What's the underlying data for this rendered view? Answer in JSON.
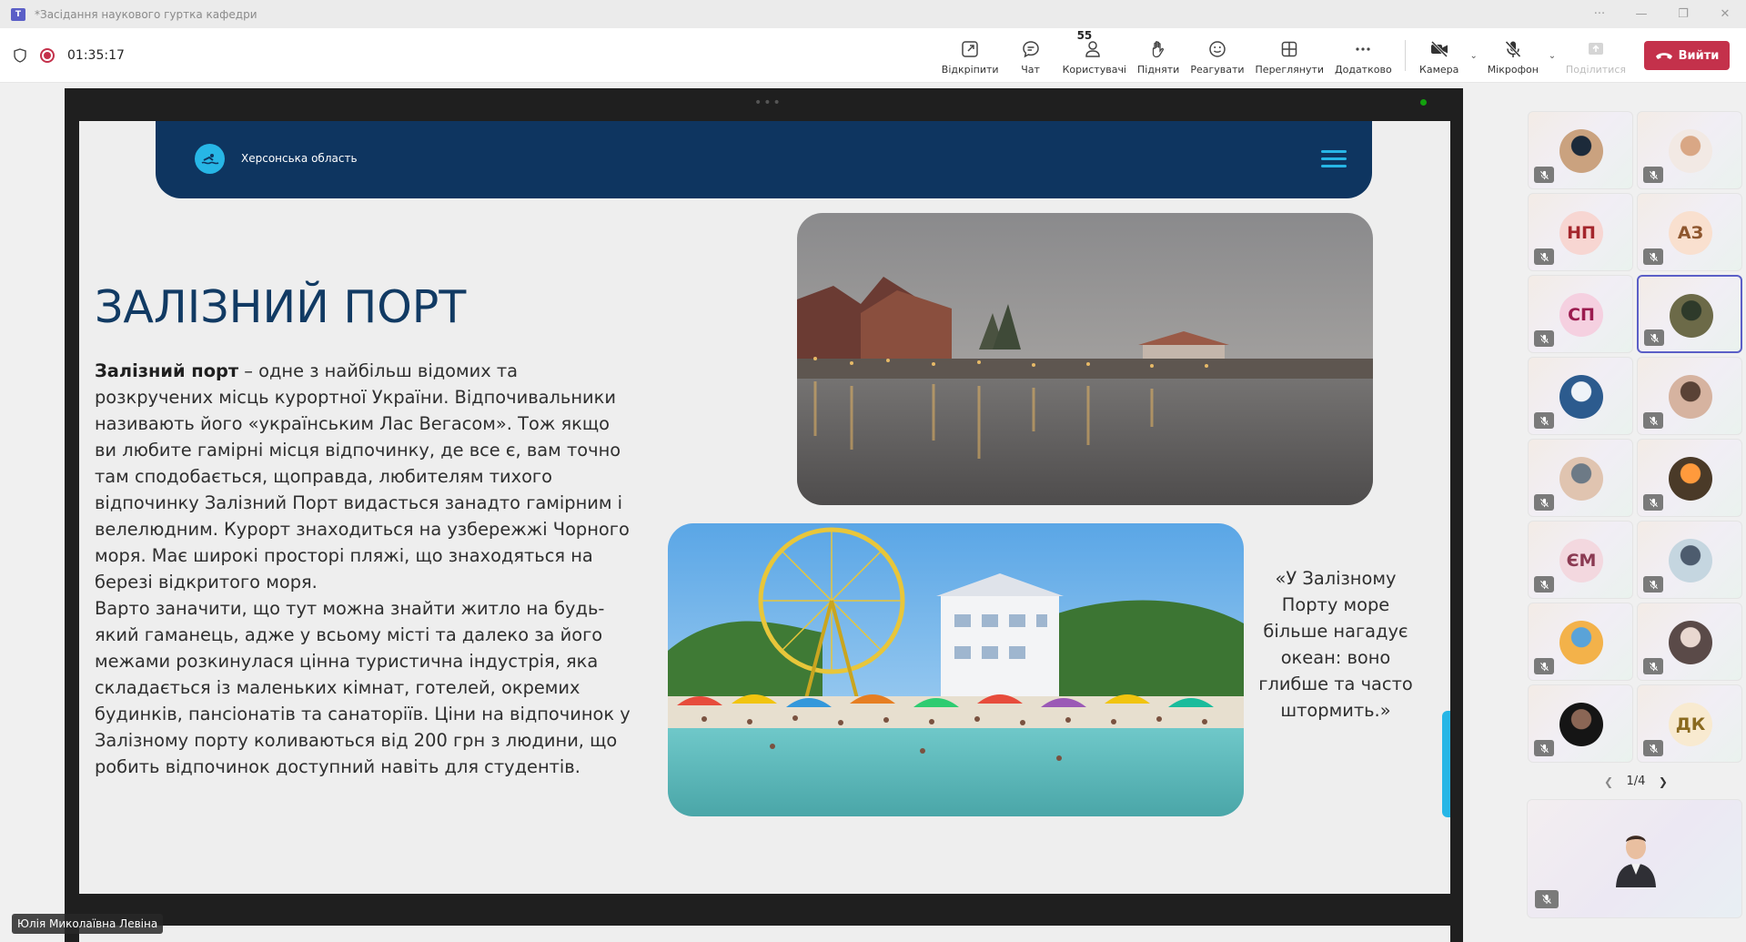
{
  "window": {
    "title": "*Засідання наукового гуртка кафедри",
    "app_icon": "T"
  },
  "toolbar": {
    "timer": "01:35:17",
    "buttons": {
      "unpin": "Відкріпити",
      "chat": "Чат",
      "people": "Користувачі",
      "people_count": "55",
      "raise": "Підняти",
      "react": "Реагувати",
      "view": "Переглянути",
      "more": "Додатково",
      "camera": "Камера",
      "mic": "Мікрофон",
      "share": "Поділитися",
      "leave": "Вийти"
    },
    "leave_color": "#c4314b"
  },
  "slide": {
    "nav_region": "Херсонська область",
    "title": "ЗАЛІЗНИЙ ПОРТ",
    "body_bold": "Залізний порт",
    "body_1": " – одне з найбільш відомих та розкручених місць курортної України. Відпочивальники називають його «українським Лас Вегасом». Тож якщо ви любите гамірні місця відпочинку, де все є, вам точно там сподобається, щоправда, любителям тихого відпочинку Залізний Порт видасться занадто гамірним і велелюдним. Курорт знаходиться на узбережжі Чорного моря. Має широкі просторі пляжі, що знаходяться на березі відкритого моря.",
    "body_2": "Варто заначити, що тут можна знайти житло на будь-який гаманець, адже у всьому місті та далеко за його межами розкинулася цінна туристична індустрія, яка складається із маленьких кімнат, готелей, окремих будинків, пансіонатів та санаторіїв. Ціни на відпочинок у Залізному порту коливаються від 200 грн з людини, що робить відпочинок доступний навіть для студентів.",
    "quote": "«У Залізному Порту море більше нагадує океан: воно глибше та часто штормить.»",
    "nav_color": "#0e3560",
    "accent_color": "#27b6e6"
  },
  "presenter": {
    "name": "Юлія Миколаївна Левіна"
  },
  "gallery": {
    "tiles": [
      {
        "kind": "photo",
        "initials": ""
      },
      {
        "kind": "photo",
        "initials": ""
      },
      {
        "kind": "initials",
        "initials": "НП",
        "bg": "#f7d6d2",
        "fg": "#a4262c"
      },
      {
        "kind": "initials",
        "initials": "АЗ",
        "bg": "#f9e0cf",
        "fg": "#8e562e"
      },
      {
        "kind": "initials",
        "initials": "СП",
        "bg": "#f5d0e0",
        "fg": "#9b1b4f"
      },
      {
        "kind": "photo",
        "initials": ""
      },
      {
        "kind": "photo",
        "initials": ""
      },
      {
        "kind": "photo",
        "initials": ""
      },
      {
        "kind": "photo",
        "initials": ""
      },
      {
        "kind": "photo",
        "initials": ""
      },
      {
        "kind": "initials",
        "initials": "ЄМ",
        "bg": "#f3d8df",
        "fg": "#8b3a52"
      },
      {
        "kind": "photo",
        "initials": ""
      },
      {
        "kind": "photo",
        "initials": ""
      },
      {
        "kind": "photo",
        "initials": ""
      },
      {
        "kind": "photo",
        "initials": ""
      },
      {
        "kind": "initials",
        "initials": "ДК",
        "bg": "#f8ead0",
        "fg": "#8a6a1f"
      }
    ],
    "pager": "1/4"
  }
}
